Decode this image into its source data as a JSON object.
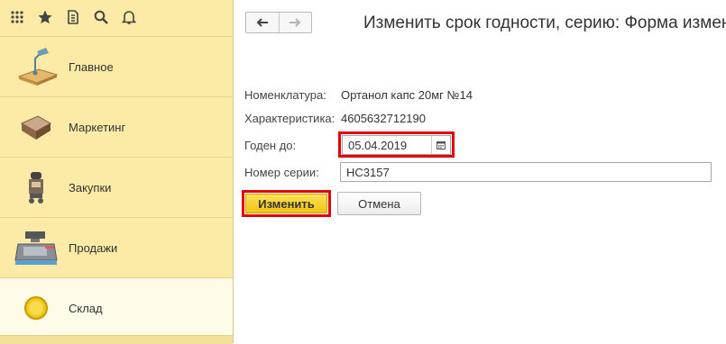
{
  "sidebar": {
    "toolbar_icons": [
      "grid-icon",
      "star-icon",
      "history-icon",
      "search-icon",
      "bell-icon"
    ],
    "items": [
      {
        "label": "Главное",
        "icon": "desk-lamp-icon",
        "active": false
      },
      {
        "label": "Маркетинг",
        "icon": "marketing-icon",
        "active": false
      },
      {
        "label": "Закупки",
        "icon": "purchases-icon",
        "active": false
      },
      {
        "label": "Продажи",
        "icon": "cash-register-icon",
        "active": false
      },
      {
        "label": "Склад",
        "icon": "warehouse-coin-icon",
        "active": true
      }
    ]
  },
  "form": {
    "title": "Изменить срок годности, серию: Форма измене",
    "nomenclature_label": "Номенклатура:",
    "nomenclature_value": "Ортанол капс 20мг №14",
    "characteristic_label": "Характеристика:",
    "characteristic_value": "4605632712190",
    "expiry_label": "Годен до:",
    "expiry_value": "05.04.2019",
    "serial_label": "Номер серии:",
    "serial_value": "НС3157",
    "apply_button": "Изменить",
    "cancel_button": "Отмена"
  },
  "colors": {
    "sidebar_bg": "#fbeba6",
    "highlight": "#e3000b",
    "primary_button": "#f2c40f"
  }
}
